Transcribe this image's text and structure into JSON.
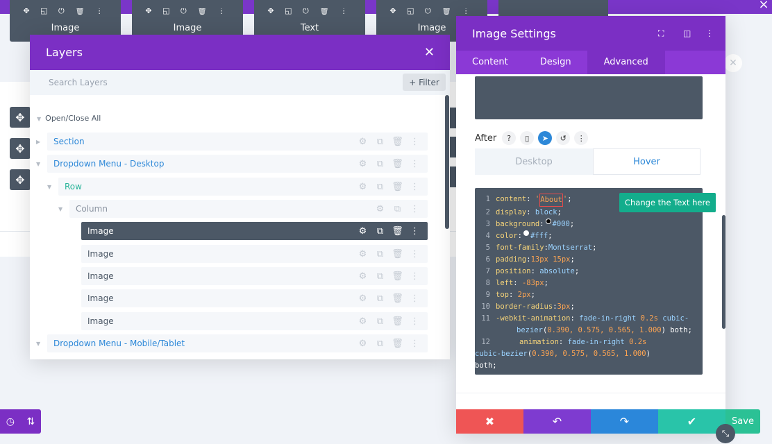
{
  "background": {
    "modules": [
      {
        "label": "Image"
      },
      {
        "label": "Image"
      },
      {
        "label": "Text"
      },
      {
        "label": "Image"
      }
    ],
    "module_icons": "✥ ◱ ⏻ 🗑 ⋮",
    "move_icon": "✥"
  },
  "layers": {
    "title": "Layers",
    "search_placeholder": "Search Layers",
    "filter_label": "+ Filter",
    "open_close_all": "Open/Close All",
    "rows": [
      {
        "label": "Section"
      },
      {
        "label": "Dropdown Menu - Desktop"
      },
      {
        "label": "Row"
      },
      {
        "label": "Column"
      },
      {
        "label": "Image"
      },
      {
        "label": "Image"
      },
      {
        "label": "Image"
      },
      {
        "label": "Image"
      },
      {
        "label": "Image"
      },
      {
        "label": "Dropdown Menu - Mobile/Tablet"
      }
    ]
  },
  "settings": {
    "title": "Image Settings",
    "tabs": [
      {
        "label": "Content"
      },
      {
        "label": "Design"
      },
      {
        "label": "Advanced"
      }
    ],
    "after_label": "After",
    "device_tabs": {
      "desktop": "Desktop",
      "hover": "Hover"
    },
    "tooltip": "Change the Text here",
    "code": {
      "l1_prop": "content",
      "l1_val": "About",
      "l2_prop": "display",
      "l2_val": "block",
      "l3_prop": "background",
      "l3_val": "#000",
      "l4_prop": "color",
      "l4_val": "#fff",
      "l5_prop": "font-family",
      "l5_val": "Montserrat",
      "l6_prop": "padding",
      "l6_val": "13px 15px",
      "l7_prop": "position",
      "l7_val": "absolute",
      "l8_prop": "left",
      "l8_val": "-83px",
      "l9_prop": "top",
      "l9_val": "2px",
      "l10_prop": "border-radius",
      "l10_val": "3px",
      "l11_prop": "-webkit-animation",
      "l11_val1": "fade-in-right",
      "l11_val2": "0.2s",
      "l11_val3": "cubic-bezier",
      "bezier_args": "0.390, 0.575, 0.565, 1.000",
      "l11_val4": "both",
      "l12_prop": "animation",
      "l12_val1": "fade-in-right",
      "l12_val2": "0.2s",
      "l12_val3": "cubic-bezier",
      "l12_val4": "both"
    },
    "save_label": "Save"
  },
  "colors": {
    "purple": "#7b2fc4",
    "red": "#ef5555",
    "violet": "#7e3bd0",
    "blue": "#2b87da",
    "green": "#29c4a9"
  }
}
